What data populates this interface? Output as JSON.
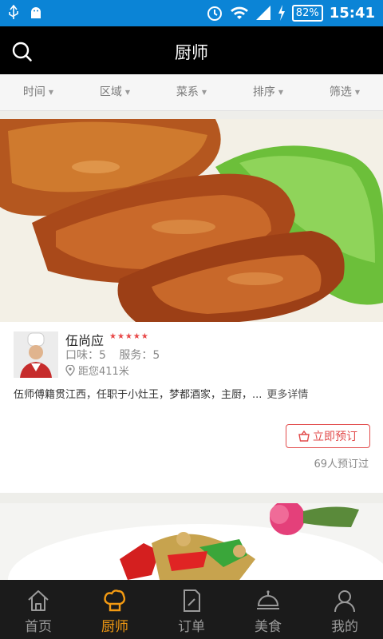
{
  "status": {
    "battery": "82%",
    "time": "15:41"
  },
  "header": {
    "title": "厨师"
  },
  "filters": [
    {
      "label": "时间"
    },
    {
      "label": "区域"
    },
    {
      "label": "菜系"
    },
    {
      "label": "排序"
    },
    {
      "label": "筛选"
    }
  ],
  "chef": {
    "name": "伍尚应",
    "rating_stars": 5,
    "taste": "口味：5",
    "service": "服务：5",
    "distance": "距您411米",
    "description": "伍师傅籍贯江西，任职于小灶王，梦都酒家，主厨，...",
    "more_label": "更多详情",
    "reserve_label": "立即预订",
    "booked_text": "69人预订过"
  },
  "tabs": [
    {
      "label": "首页",
      "icon": "home-icon"
    },
    {
      "label": "厨师",
      "icon": "chef-hat-icon"
    },
    {
      "label": "订单",
      "icon": "order-icon"
    },
    {
      "label": "美食",
      "icon": "dish-icon"
    },
    {
      "label": "我的",
      "icon": "user-icon"
    }
  ],
  "colors": {
    "status_bar": "#0b84d6",
    "accent": "#f39a12",
    "reserve": "#e24b4b",
    "stars": "#e84848"
  }
}
